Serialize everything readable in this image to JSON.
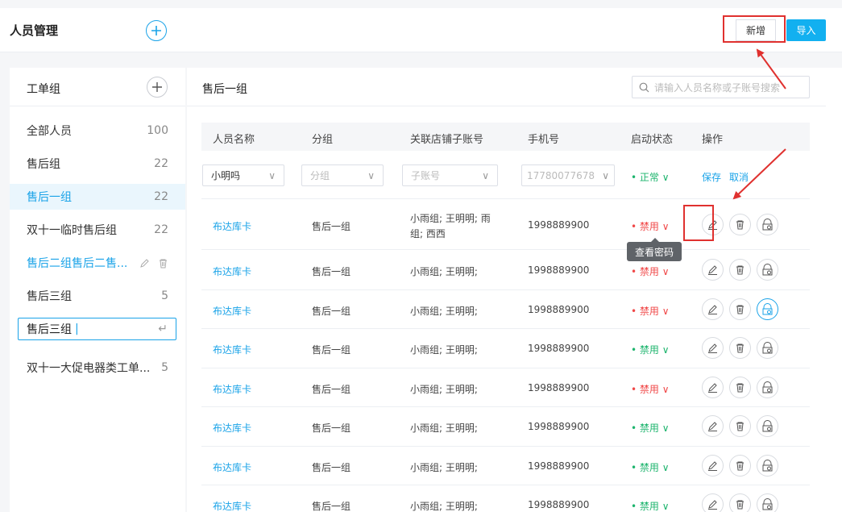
{
  "header": {
    "title": "人员管理",
    "new_button": "新增",
    "import_button": "导入"
  },
  "left": {
    "title": "工单组",
    "groups": [
      {
        "name": "全部人员",
        "count": "100"
      },
      {
        "name": "售后组",
        "count": "22"
      },
      {
        "name": "售后一组",
        "count": "22"
      },
      {
        "name": "双十一临时售后组",
        "count": "22"
      },
      {
        "name": "售后二组售后二售...",
        "count": ""
      },
      {
        "name": "售后三组",
        "count": "5"
      },
      {
        "name": "双十一大促电器类工单...",
        "count": "5"
      }
    ],
    "edit_value": "售后三组",
    "edit_caret": "|"
  },
  "right": {
    "title": "售后一组",
    "search_placeholder": "请输入人员名称或子账号搜索",
    "columns": [
      "人员名称",
      "分组",
      "关联店铺子账号",
      "手机号",
      "启动状态",
      "操作"
    ],
    "filter": {
      "name": "小明吗",
      "group_placeholder": "分组",
      "sub_placeholder": "子账号",
      "phone": "17780077678",
      "status": "• 正常 ∨",
      "save": "保存",
      "cancel": "取消"
    },
    "rows": [
      {
        "name": "布达库卡",
        "group": "售后一组",
        "sub1": "小雨组; 王明明; 雨",
        "sub2": "组; 西西",
        "phone": "1998889900",
        "status": "• 禁用 ∨"
      },
      {
        "name": "布达库卡",
        "group": "售后一组",
        "sub1": "小雨组; 王明明;",
        "sub2": "",
        "phone": "1998889900",
        "status": "• 禁用 ∨"
      },
      {
        "name": "布达库卡",
        "group": "售后一组",
        "sub1": "小雨组; 王明明;",
        "sub2": "",
        "phone": "1998889900",
        "status": "• 禁用 ∨"
      },
      {
        "name": "布达库卡",
        "group": "售后一组",
        "sub1": "小雨组; 王明明;",
        "sub2": "",
        "phone": "1998889900",
        "status": "• 禁用 ∨"
      },
      {
        "name": "布达库卡",
        "group": "售后一组",
        "sub1": "小雨组; 王明明;",
        "sub2": "",
        "phone": "1998889900",
        "status": "• 禁用 ∨"
      },
      {
        "name": "布达库卡",
        "group": "售后一组",
        "sub1": "小雨组; 王明明;",
        "sub2": "",
        "phone": "1998889900",
        "status": "• 禁用 ∨"
      },
      {
        "name": "布达库卡",
        "group": "售后一组",
        "sub1": "小雨组; 王明明;",
        "sub2": "",
        "phone": "1998889900",
        "status": "• 禁用 ∨"
      },
      {
        "name": "布达库卡",
        "group": "售后一组",
        "sub1": "小雨组; 王明明;",
        "sub2": "",
        "phone": "1998889900",
        "status": "• 禁用 ∨"
      }
    ],
    "tooltip": "查看密码"
  },
  "colors": {
    "accent": "#1aa3e8",
    "import_bg": "#12b0f0",
    "danger": "#f04848",
    "success": "#1db46d",
    "annotation": "#e0312f"
  }
}
